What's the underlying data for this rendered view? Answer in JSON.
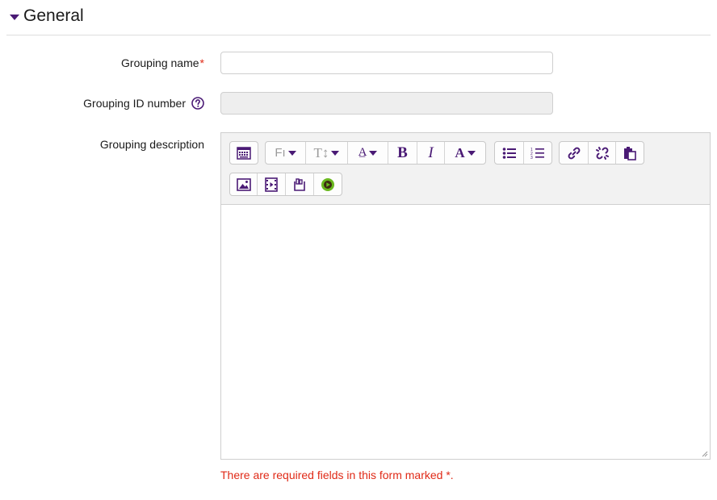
{
  "section": {
    "title": "General",
    "toggle_icon": "caret-down-icon"
  },
  "fields": {
    "grouping_name": {
      "label": "Grouping name",
      "required_marker": "*",
      "value": ""
    },
    "grouping_id": {
      "label": "Grouping ID number",
      "value": "",
      "help_icon": "question-circle-icon"
    },
    "grouping_description": {
      "label": "Grouping description",
      "value": ""
    }
  },
  "toolbar": {
    "row1": [
      {
        "name": "toolbar-toggle",
        "icon": "keyboard-icon"
      },
      {
        "name": "font-family",
        "text": "Fı",
        "dropdown": true
      },
      {
        "name": "font-size",
        "text": "T↕",
        "dropdown": true
      },
      {
        "name": "font-style",
        "text": "A̲",
        "dropdown": true
      },
      {
        "name": "bold",
        "text": "B"
      },
      {
        "name": "italic",
        "text": "I"
      },
      {
        "name": "text-color",
        "text": "A",
        "dropdown": true
      },
      {
        "name": "unordered-list",
        "icon": "bullet-list-icon"
      },
      {
        "name": "ordered-list",
        "icon": "numbered-list-icon"
      },
      {
        "name": "link",
        "icon": "link-icon"
      },
      {
        "name": "unlink",
        "icon": "unlink-icon"
      },
      {
        "name": "paste",
        "icon": "clipboard-icon"
      }
    ],
    "row2": [
      {
        "name": "insert-image",
        "icon": "image-icon"
      },
      {
        "name": "insert-media",
        "icon": "film-icon"
      },
      {
        "name": "manage-files",
        "icon": "files-icon"
      },
      {
        "name": "record-video",
        "icon": "play-circle-icon"
      }
    ]
  },
  "footer": {
    "required_note": "There are required fields in this form marked *."
  },
  "colors": {
    "accent": "#4a1a75",
    "required": "#e02a17",
    "toolbar_bg": "#f2f2f2",
    "play_green": "#6ab81f"
  }
}
